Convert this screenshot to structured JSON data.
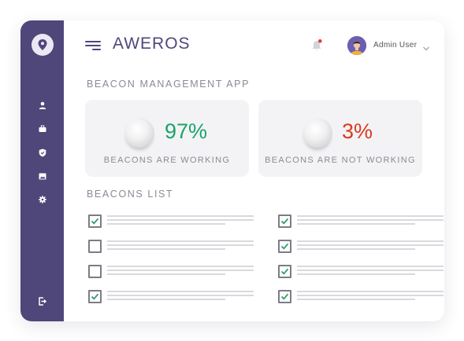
{
  "sidebar": {
    "logo_icon": "location-pin-icon",
    "items": [
      {
        "name": "user",
        "icon": "user-icon"
      },
      {
        "name": "briefcase",
        "icon": "briefcase-icon"
      },
      {
        "name": "shield",
        "icon": "shield-icon"
      },
      {
        "name": "image",
        "icon": "image-icon"
      },
      {
        "name": "settings",
        "icon": "gear-icon"
      }
    ],
    "logout_icon": "logout-icon"
  },
  "header": {
    "brand": "AWEROS",
    "notification_icon": "bell-icon",
    "user_name": "Admin User"
  },
  "app_title": "BEACON MANAGEMENT APP",
  "stats": [
    {
      "value": "97%",
      "label": "BEACONS ARE WORKING",
      "color": "#1aa36b"
    },
    {
      "value": "3%",
      "label": "BEACONS ARE NOT WORKING",
      "color": "#d93a1e"
    }
  ],
  "list_title": "BEACONS LIST",
  "beacons": [
    {
      "checked": true
    },
    {
      "checked": false
    },
    {
      "checked": false
    },
    {
      "checked": true
    },
    {
      "checked": true
    },
    {
      "checked": true
    },
    {
      "checked": true
    },
    {
      "checked": true
    }
  ],
  "colors": {
    "sidebar": "#4f477a",
    "notification_dot": "#e83a2e",
    "check": "#2e9e6a"
  }
}
